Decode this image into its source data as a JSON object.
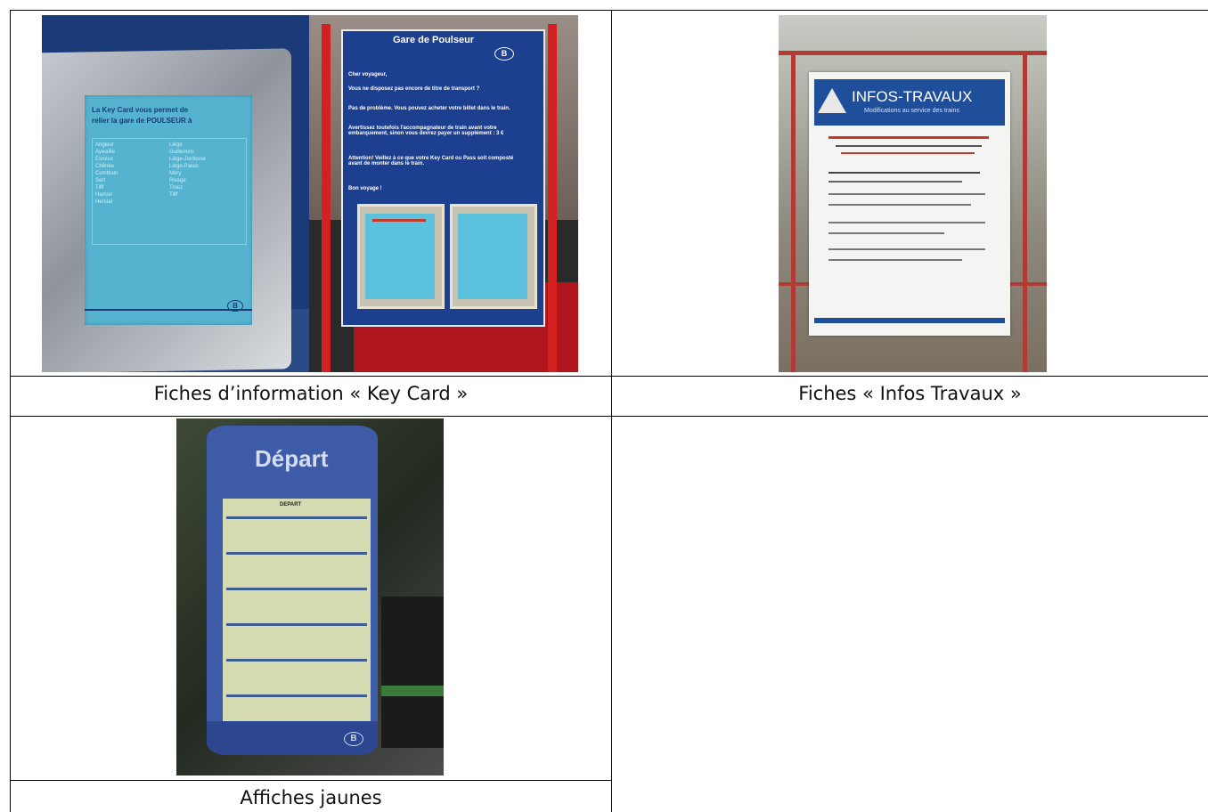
{
  "captions": {
    "key_card": "Fiches d’information « Key Card »",
    "infos_travaux": "Fiches « Infos Travaux »",
    "affiches": "Affiches jaunes"
  },
  "photo_keycard": {
    "card_text_1": "La Key Card vous permet de",
    "card_text_2": "relier la gare de POULSEUR à",
    "left_list": [
      "Angleur",
      "Aywaille",
      "Esneux",
      "Chênée",
      "Comblain",
      "Sart",
      "Tilff",
      "Hamoir",
      "Herstal"
    ],
    "right_list": [
      "Liège",
      "Guillemins",
      "Liège-Jonfosse",
      "Liège-Palais",
      "Méry",
      "Rivage",
      "Trooz",
      "Tilff"
    ],
    "logo": "B"
  },
  "photo_sign": {
    "title": "Gare de Poulseur",
    "logo": "B",
    "greeting": "Cher voyageur,",
    "body_1": "Vous ne disposez pas encore de titre de transport ?",
    "body_2": "Pas de problème. Vous pouvez acheter votre billet dans le train.",
    "body_3": "Avertissez toutefois l'accompagnateur de train avant votre embarquement, sinon vous devrez payer un supplément : 3 €",
    "body_4": "Attention! Veillez à ce que votre Key Card ou Pass soit composté avant de monter dans le train.",
    "closing": "Bon voyage !"
  },
  "photo_travaux": {
    "header": "INFOS-TRAVAUX",
    "subheader": "Modifications au service des trains"
  },
  "photo_depart": {
    "header": "Départ",
    "table_title": "DEPART",
    "logo": "B"
  }
}
